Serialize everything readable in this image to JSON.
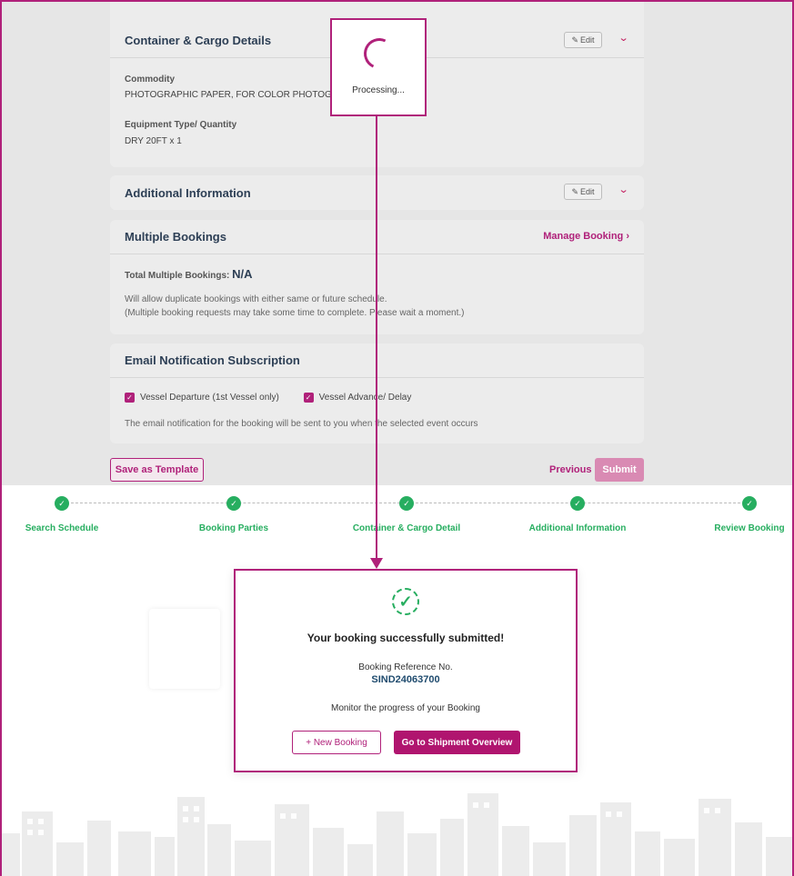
{
  "processing": {
    "text": "Processing..."
  },
  "cards": {
    "container": {
      "title": "Container & Cargo Details",
      "edit": "Edit",
      "commodity_label": "Commodity",
      "commodity_value": "PHOTOGRAPHIC PAPER, FOR COLOR PHOTOGR",
      "equipment_label": "Equipment Type/ Quantity",
      "equipment_value": "DRY 20FT x 1"
    },
    "additional": {
      "title": "Additional Information",
      "edit": "Edit"
    },
    "multiple": {
      "title": "Multiple Bookings",
      "manage": "Manage Booking",
      "total_label": "Total Multiple Bookings:",
      "total_value": "N/A",
      "note1": "Will allow duplicate bookings with either same or future schedule.",
      "note2": "(Multiple booking requests may take some time to complete. Please wait a moment.)"
    },
    "email": {
      "title": "Email Notification Subscription",
      "opt1": "Vessel Departure (1st Vessel only)",
      "opt2": "Vessel Advance/ Delay",
      "note": "The email notification for the booking will be sent to you when the selected event occurs"
    }
  },
  "actions": {
    "template": "Save as Template",
    "previous": "Previous",
    "submit": "Submit"
  },
  "steps": [
    {
      "label": "Search Schedule"
    },
    {
      "label": "Booking Parties"
    },
    {
      "label": "Container & Cargo Detail"
    },
    {
      "label": "Additional Information"
    },
    {
      "label": "Review Booking"
    }
  ],
  "success": {
    "title": "Your booking successfully submitted!",
    "ref_label": "Booking Reference No.",
    "ref_value": "SIND24063700",
    "monitor": "Monitor the progress of your Booking",
    "new_booking": "+ New Booking",
    "go_overview": "Go to Shipment Overview"
  },
  "colors": {
    "accent": "#b0217a",
    "success": "#27ae60",
    "ref": "#1f4b6e"
  }
}
